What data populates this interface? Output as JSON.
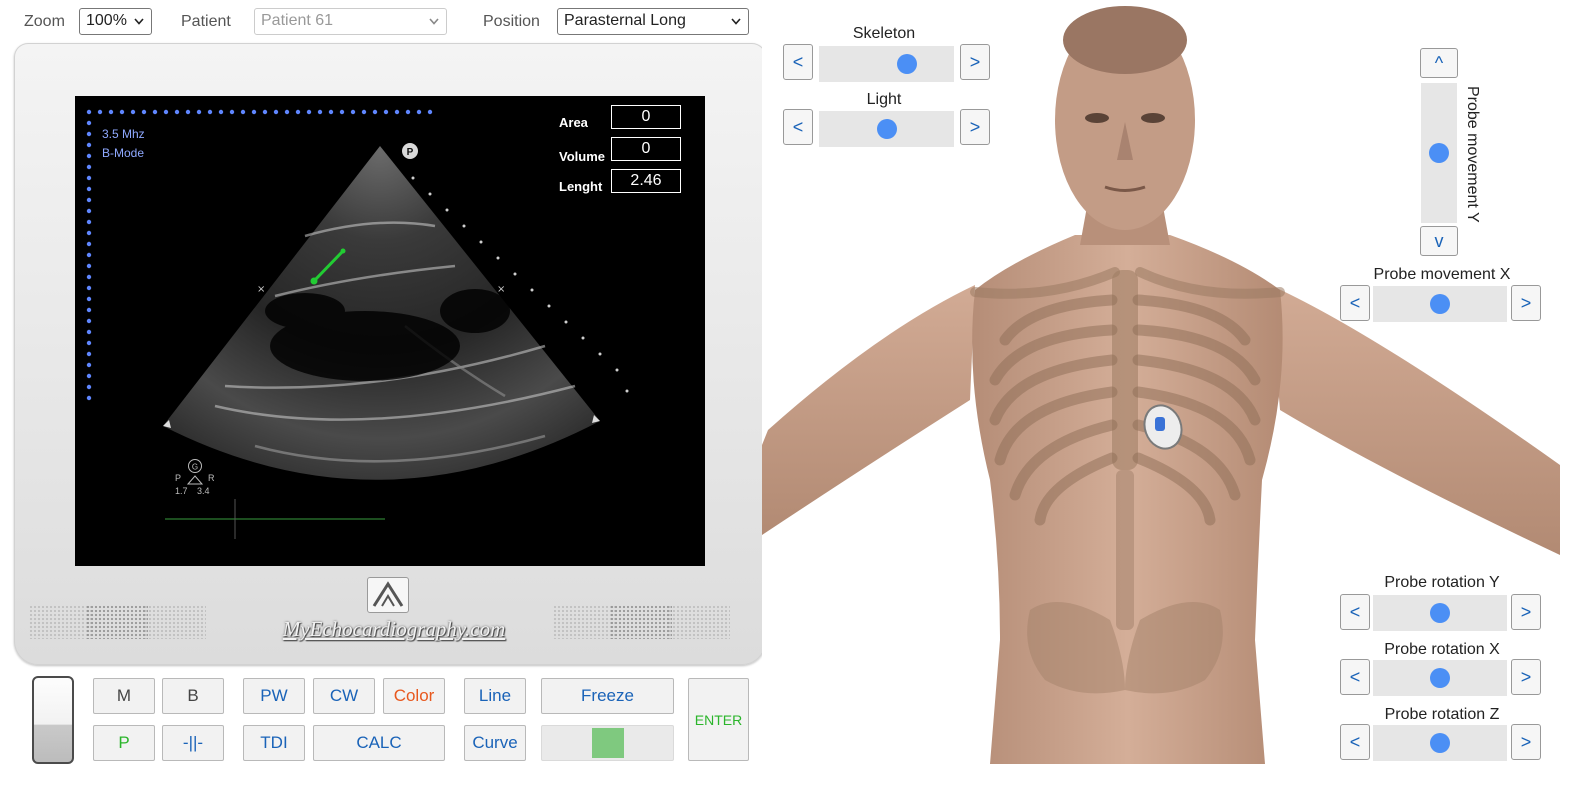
{
  "toolbar": {
    "zoom_label": "Zoom",
    "zoom_value": "100%",
    "patient_label": "Patient",
    "patient_value": "Patient 61",
    "position_label": "Position",
    "position_value": "Parasternal Long"
  },
  "screen": {
    "frequency": "3.5 Mhz",
    "mode": "B-Mode",
    "orientation_marker": "P",
    "measurements": [
      {
        "label": "Area",
        "value": "0"
      },
      {
        "label": "Volume",
        "value": "0"
      },
      {
        "label": "Lenght",
        "value": "2.46"
      }
    ],
    "depth_marker": {
      "top": "G",
      "left": "P",
      "right": "R",
      "val1": "1.7",
      "val2": "3.4"
    }
  },
  "monitor": {
    "brand": "MyEchocardiography.com"
  },
  "controls": {
    "row1": [
      "M",
      "B",
      "PW",
      "CW",
      "Color",
      "Line",
      "Freeze"
    ],
    "row2": [
      "P",
      "-||-",
      "TDI",
      "CALC",
      "Curve"
    ],
    "enter": "ENTER",
    "indicator_color": "#7fc97f"
  },
  "viewer": {
    "skeleton": {
      "label": "Skeleton",
      "level": 0.68
    },
    "light": {
      "label": "Light",
      "level": 0.5
    },
    "probe_y": {
      "label": "Probe movement Y",
      "level": 0.5
    },
    "probe_x": {
      "label": "Probe movement X",
      "level": 0.5
    },
    "rot_y": {
      "label": "Probe rotation Y",
      "level": 0.5
    },
    "rot_x": {
      "label": "Probe rotation X",
      "level": 0.5
    },
    "rot_z": {
      "label": "Probe rotation Z",
      "level": 0.5
    },
    "prev_glyph": "<",
    "next_glyph": ">",
    "up_glyph": "^",
    "down_glyph": "v"
  },
  "colors": {
    "accent_blue": "#1a63b8",
    "slider_thumb": "#4b8ff5",
    "color_button": "#e8581e",
    "p_button": "#2bb52b",
    "measure_line": "#22cc33"
  }
}
